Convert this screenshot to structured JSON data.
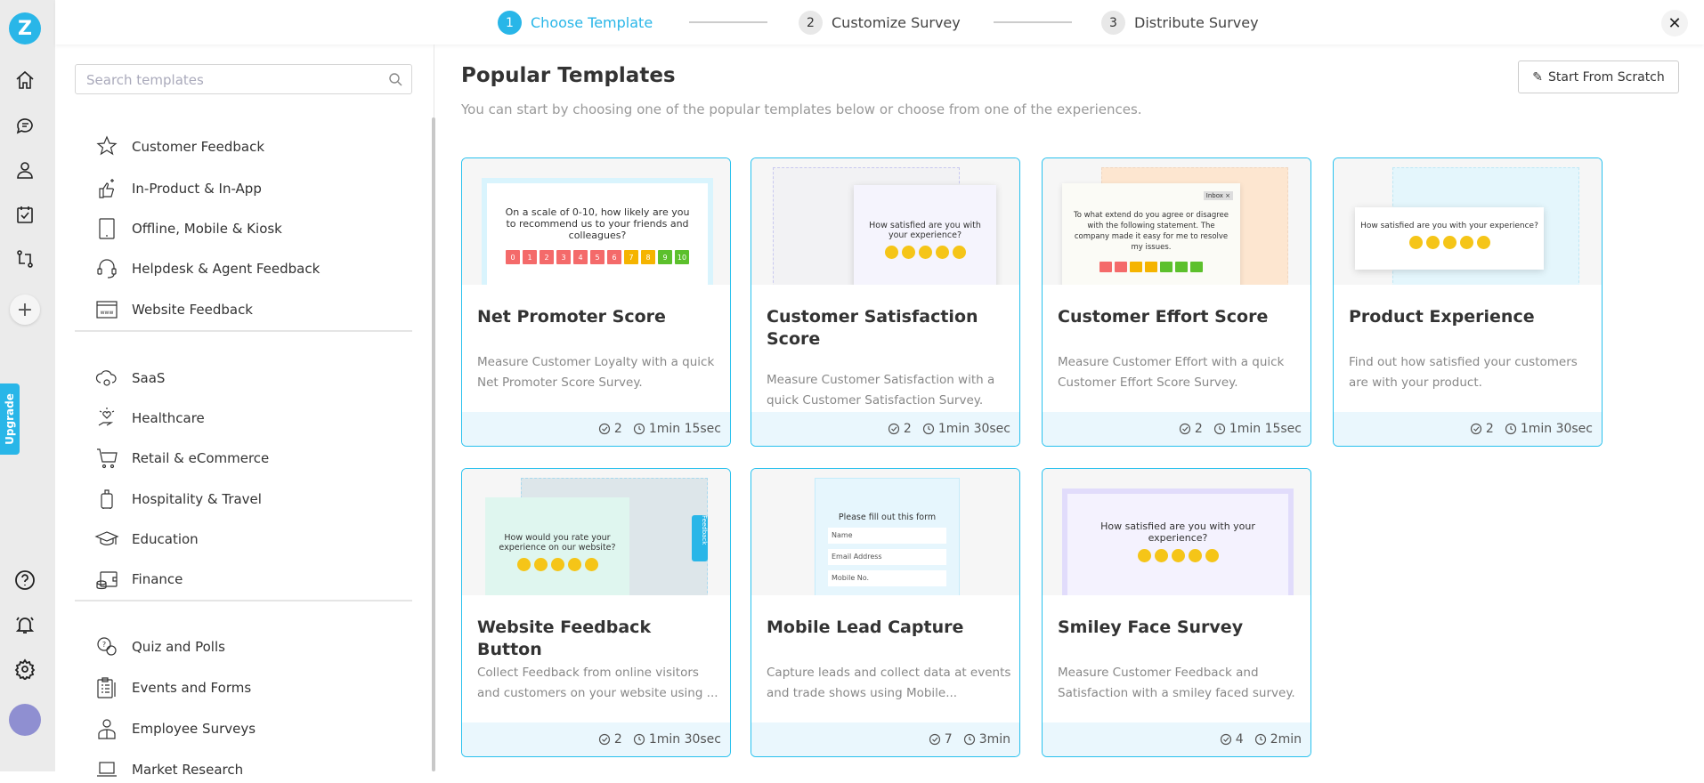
{
  "rail": {
    "logo": "Z",
    "upgrade": "Upgrade",
    "icons": [
      "home-icon",
      "chat-icon",
      "user-icon",
      "calendar-check-icon",
      "workflow-icon",
      "plus-icon",
      "help-icon",
      "bell-icon",
      "gear-icon",
      "avatar"
    ]
  },
  "stepper": {
    "steps": [
      {
        "num": "1",
        "label": "Choose Template",
        "active": true
      },
      {
        "num": "2",
        "label": "Customize Survey"
      },
      {
        "num": "3",
        "label": "Distribute Survey"
      }
    ],
    "close": "✕"
  },
  "sidebar": {
    "search_placeholder": "Search templates",
    "groups": [
      [
        {
          "label": "Customer Feedback",
          "icon": "star-icon"
        },
        {
          "label": "In-Product & In-App",
          "icon": "thumbs-up-sparkle-icon"
        },
        {
          "label": "Offline, Mobile & Kiosk",
          "icon": "tablet-icon"
        },
        {
          "label": "Helpdesk & Agent Feedback",
          "icon": "headset-icon"
        },
        {
          "label": "Website Feedback",
          "icon": "www-icon"
        }
      ],
      [
        {
          "label": "SaaS",
          "icon": "cloud-gear-icon"
        },
        {
          "label": "Healthcare",
          "icon": "heart-hand-icon"
        },
        {
          "label": "Retail & eCommerce",
          "icon": "cart-icon"
        },
        {
          "label": "Hospitality & Travel",
          "icon": "luggage-icon"
        },
        {
          "label": "Education",
          "icon": "graduation-cap-icon"
        },
        {
          "label": "Finance",
          "icon": "wallet-icon"
        }
      ],
      [
        {
          "label": "Quiz and Polls",
          "icon": "quiz-icon"
        },
        {
          "label": "Events and Forms",
          "icon": "clipboard-icon"
        },
        {
          "label": "Employee Surveys",
          "icon": "employee-icon"
        },
        {
          "label": "Market Research",
          "icon": "laptop-icon"
        }
      ]
    ]
  },
  "main": {
    "title": "Popular Templates",
    "subtitle": "You can start by choosing one of the popular templates below or choose from one of the experiences.",
    "scratch_label": "Start From Scratch",
    "cards": [
      {
        "title": "Net Promoter Score",
        "desc": "Measure Customer Loyalty with a quick Net Promoter Score Survey.",
        "questions": "2",
        "time": "1min 15sec",
        "preview": "On a scale of 0-10, how likely are you to recommend us to your friends and colleagues?"
      },
      {
        "title": "Customer Satisfaction Score",
        "desc": "Measure Customer Satisfaction with a quick Customer Satisfaction Survey.",
        "questions": "2",
        "time": "1min 30sec",
        "preview": "How satisfied are you with your experience?"
      },
      {
        "title": "Customer Effort Score",
        "desc": "Measure Customer Effort with a quick Customer Effort Score Survey.",
        "questions": "2",
        "time": "1min 15sec",
        "preview": "To what extend do you agree or disagree with the following statement. The company made it easy for me to resolve my issues.",
        "inbox": "Inbox ×"
      },
      {
        "title": "Product Experience",
        "desc": "Find out how satisfied your customers are with your product.",
        "questions": "2",
        "time": "1min 30sec",
        "preview": "How satisfied are you with your experience?"
      },
      {
        "title": "Website Feedback Button",
        "desc": "Collect Feedback from online visitors and customers on your website using ...",
        "questions": "2",
        "time": "1min 30sec",
        "preview": "How would you rate your experience on our website?",
        "tab": "Feedback"
      },
      {
        "title": "Mobile Lead Capture",
        "desc": "Capture leads and collect data at events and trade shows using Mobile...",
        "questions": "7",
        "time": "3min",
        "preview": "Please fill out this form",
        "fields": [
          "Name",
          "Email Address",
          "Mobile No."
        ]
      },
      {
        "title": "Smiley Face Survey",
        "desc": "Measure Customer Feedback and Satisfaction with a smiley faced survey.",
        "questions": "4",
        "time": "2min",
        "preview": "How satisfied are you with your experience?"
      }
    ]
  },
  "colors": {
    "accent": "#29b6e8",
    "card_border": "#29c1ee",
    "footer_bg": "#eaf7fd",
    "avatar": "#8f8fd1",
    "nps": [
      "#f46a6a",
      "#f46a6a",
      "#f46a6a",
      "#f46a6a",
      "#f46a6a",
      "#f46a6a",
      "#f46a6a",
      "#f5b400",
      "#f5b400",
      "#5cc02c",
      "#5cc02c"
    ]
  }
}
